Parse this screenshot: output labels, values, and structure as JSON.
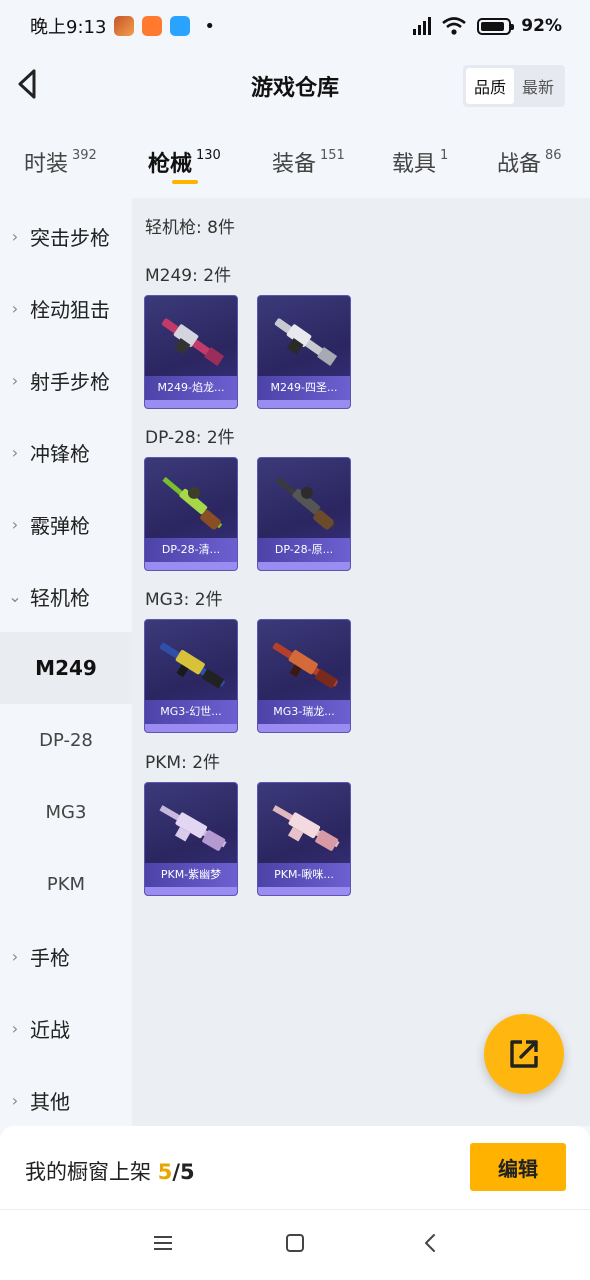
{
  "status_bar": {
    "time": "晚上9:13",
    "battery": "92%"
  },
  "header": {
    "title": "游戏仓库",
    "sort_quality": "品质",
    "sort_latest": "最新"
  },
  "tabs": [
    {
      "label": "时装",
      "count": "392"
    },
    {
      "label": "枪械",
      "count": "130"
    },
    {
      "label": "装备",
      "count": "151"
    },
    {
      "label": "载具",
      "count": "1"
    },
    {
      "label": "战备",
      "count": "86"
    }
  ],
  "sidebar": {
    "categories": [
      {
        "label": "突击步枪"
      },
      {
        "label": "栓动狙击"
      },
      {
        "label": "射手步枪"
      },
      {
        "label": "冲锋枪"
      },
      {
        "label": "霰弹枪"
      },
      {
        "label": "轻机枪"
      }
    ],
    "sub_items": [
      {
        "label": "M249"
      },
      {
        "label": "DP-28"
      },
      {
        "label": "MG3"
      },
      {
        "label": "PKM"
      }
    ],
    "more": [
      {
        "label": "手枪"
      },
      {
        "label": "近战"
      },
      {
        "label": "其他"
      }
    ]
  },
  "main": {
    "count_line": "轻机枪: 8件",
    "groups": [
      {
        "title": "M249: 2件",
        "items": [
          {
            "name": "M249-焰龙..."
          },
          {
            "name": "M249-四圣..."
          }
        ]
      },
      {
        "title": "DP-28: 2件",
        "items": [
          {
            "name": "DP-28-清..."
          },
          {
            "name": "DP-28-原..."
          }
        ]
      },
      {
        "title": "MG3: 2件",
        "items": [
          {
            "name": "MG3-幻世..."
          },
          {
            "name": "MG3-瑞龙..."
          }
        ]
      },
      {
        "title": "PKM: 2件",
        "items": [
          {
            "name": "PKM-紫幽梦"
          },
          {
            "name": "PKM-啾咪..."
          }
        ]
      }
    ]
  },
  "shelf": {
    "label": "我的橱窗上架",
    "current": "5",
    "separator_total": "/5",
    "edit_label": "编辑"
  },
  "colors": {
    "accent": "#ffb300",
    "card_bg": "#2b2660",
    "caption_bg": "#5a4fc0"
  }
}
